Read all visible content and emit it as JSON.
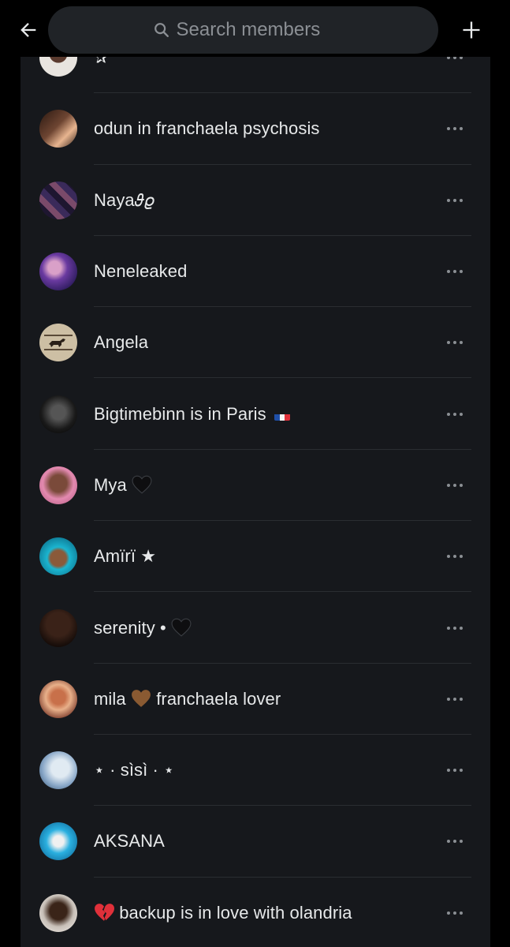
{
  "header": {
    "back_label": "Back",
    "search": {
      "placeholder": "Search members",
      "value": ""
    },
    "add_label": "Add member"
  },
  "members": [
    {
      "name": "✰",
      "avatar": "avatar-portrait"
    },
    {
      "name": "odun in franchaela psychosis",
      "avatar": "avatar-hands"
    },
    {
      "name": "Naya𝜗𝜚",
      "avatar": "avatar-collage"
    },
    {
      "name": "Neneleaked",
      "avatar": "avatar-purple"
    },
    {
      "name": "Angela",
      "avatar": "avatar-horse"
    },
    {
      "name": "Bigtimebinn is in Paris",
      "avatar": "avatar-bw",
      "flag": "french-flag"
    },
    {
      "name": "Mya",
      "avatar": "avatar-pink",
      "emoji": "black-heart"
    },
    {
      "name": "Amïrï ★",
      "avatar": "avatar-blue-hair"
    },
    {
      "name": "serenity •",
      "avatar": "avatar-afro",
      "emoji": "black-heart"
    },
    {
      "name": "mila",
      "name_suffix": "franchaela lover",
      "avatar": "avatar-red",
      "emoji": "brown-heart"
    },
    {
      "name": "⋆ · sìsì · ⋆",
      "avatar": "avatar-light"
    },
    {
      "name": "AKSANA",
      "avatar": "avatar-bunny"
    },
    {
      "name": "backup is in love with olandria",
      "avatar": "avatar-sitting",
      "emoji_prefix": "broken-heart"
    }
  ],
  "colors": {
    "background": "#000000",
    "panel": "#16181c",
    "search_bg": "#202327",
    "text": "#e7e9ea",
    "muted": "#8b8f94"
  }
}
